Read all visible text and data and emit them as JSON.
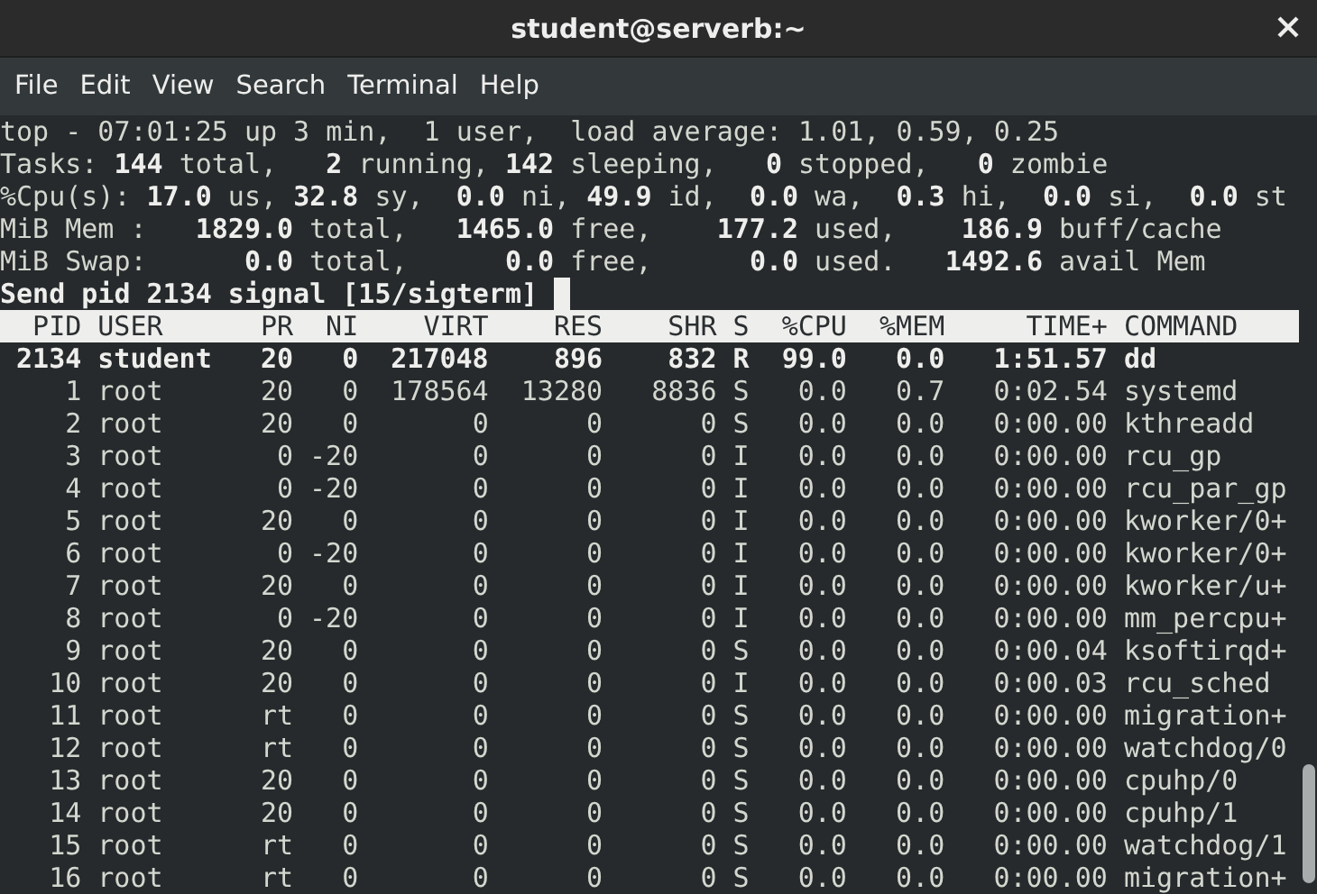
{
  "window": {
    "title": "student@serverb:~"
  },
  "menu": [
    "File",
    "Edit",
    "View",
    "Search",
    "Terminal",
    "Help"
  ],
  "summary": [
    "top - 07:01:25 up 3 min,  1 user,  load average: 1.01, 0.59, 0.25",
    "Tasks: **144** total,   **2** running, **142** sleeping,   **0** stopped,   **0** zombie",
    "%Cpu(s): **17.0** us, **32.8** sy,  **0.0** ni, **49.9** id,  **0.0** wa,  **0.3** hi,  **0.0** si,  **0.0** st",
    "MiB Mem :   **1829.0** total,   **1465.0** free,    **177.2** used,    **186.9** buff/cache",
    "MiB Swap:      **0.0** total,      **0.0** free,      **0.0** used.   **1492.6** avail Mem"
  ],
  "prompt": "Send pid 2134 signal [15/sigterm]",
  "table": {
    "columns": [
      "PID",
      "USER",
      "PR",
      "NI",
      "VIRT",
      "RES",
      "SHR",
      "S",
      "%CPU",
      "%MEM",
      "TIME+",
      "COMMAND"
    ],
    "rows": [
      {
        "cells": [
          "2134",
          "student",
          "20",
          "0",
          "217048",
          "896",
          "832",
          "R",
          "99.0",
          "0.0",
          "1:51.57",
          "dd"
        ],
        "running": true
      },
      {
        "cells": [
          "1",
          "root",
          "20",
          "0",
          "178564",
          "13280",
          "8836",
          "S",
          "0.0",
          "0.7",
          "0:02.54",
          "systemd"
        ],
        "running": false
      },
      {
        "cells": [
          "2",
          "root",
          "20",
          "0",
          "0",
          "0",
          "0",
          "S",
          "0.0",
          "0.0",
          "0:00.00",
          "kthreadd"
        ],
        "running": false
      },
      {
        "cells": [
          "3",
          "root",
          "0",
          "-20",
          "0",
          "0",
          "0",
          "I",
          "0.0",
          "0.0",
          "0:00.00",
          "rcu_gp"
        ],
        "running": false
      },
      {
        "cells": [
          "4",
          "root",
          "0",
          "-20",
          "0",
          "0",
          "0",
          "I",
          "0.0",
          "0.0",
          "0:00.00",
          "rcu_par_gp"
        ],
        "running": false
      },
      {
        "cells": [
          "5",
          "root",
          "20",
          "0",
          "0",
          "0",
          "0",
          "I",
          "0.0",
          "0.0",
          "0:00.00",
          "kworker/0+"
        ],
        "running": false
      },
      {
        "cells": [
          "6",
          "root",
          "0",
          "-20",
          "0",
          "0",
          "0",
          "I",
          "0.0",
          "0.0",
          "0:00.00",
          "kworker/0+"
        ],
        "running": false
      },
      {
        "cells": [
          "7",
          "root",
          "20",
          "0",
          "0",
          "0",
          "0",
          "I",
          "0.0",
          "0.0",
          "0:00.00",
          "kworker/u+"
        ],
        "running": false
      },
      {
        "cells": [
          "8",
          "root",
          "0",
          "-20",
          "0",
          "0",
          "0",
          "I",
          "0.0",
          "0.0",
          "0:00.00",
          "mm_percpu+"
        ],
        "running": false
      },
      {
        "cells": [
          "9",
          "root",
          "20",
          "0",
          "0",
          "0",
          "0",
          "S",
          "0.0",
          "0.0",
          "0:00.04",
          "ksoftirqd+"
        ],
        "running": false
      },
      {
        "cells": [
          "10",
          "root",
          "20",
          "0",
          "0",
          "0",
          "0",
          "I",
          "0.0",
          "0.0",
          "0:00.03",
          "rcu_sched"
        ],
        "running": false
      },
      {
        "cells": [
          "11",
          "root",
          "rt",
          "0",
          "0",
          "0",
          "0",
          "S",
          "0.0",
          "0.0",
          "0:00.00",
          "migration+"
        ],
        "running": false
      },
      {
        "cells": [
          "12",
          "root",
          "rt",
          "0",
          "0",
          "0",
          "0",
          "S",
          "0.0",
          "0.0",
          "0:00.00",
          "watchdog/0"
        ],
        "running": false
      },
      {
        "cells": [
          "13",
          "root",
          "20",
          "0",
          "0",
          "0",
          "0",
          "S",
          "0.0",
          "0.0",
          "0:00.00",
          "cpuhp/0"
        ],
        "running": false
      },
      {
        "cells": [
          "14",
          "root",
          "20",
          "0",
          "0",
          "0",
          "0",
          "S",
          "0.0",
          "0.0",
          "0:00.00",
          "cpuhp/1"
        ],
        "running": false
      },
      {
        "cells": [
          "15",
          "root",
          "rt",
          "0",
          "0",
          "0",
          "0",
          "S",
          "0.0",
          "0.0",
          "0:00.00",
          "watchdog/1"
        ],
        "running": false
      },
      {
        "cells": [
          "16",
          "root",
          "rt",
          "0",
          "0",
          "0",
          "0",
          "S",
          "0.0",
          "0.0",
          "0:00.00",
          "migration+"
        ],
        "running": false
      }
    ]
  }
}
